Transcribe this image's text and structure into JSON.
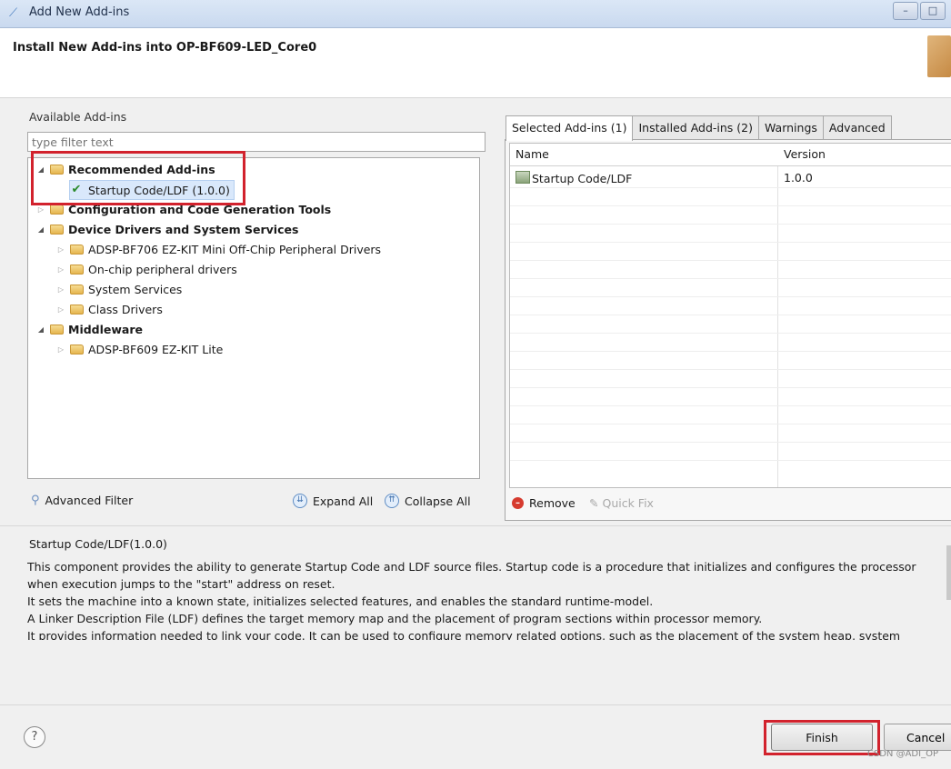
{
  "window": {
    "title": "Add New Add-ins"
  },
  "header": {
    "title": "Install New Add-ins into OP-BF609-LED_Core0"
  },
  "left": {
    "label": "Available Add-ins",
    "filter_placeholder": "type filter text",
    "tree": [
      {
        "text": "Recommended Add-ins"
      },
      {
        "text": "Startup Code/LDF (1.0.0)"
      },
      {
        "text": "Configuration and Code Generation Tools"
      },
      {
        "text": "Device Drivers and System Services"
      },
      {
        "text": "ADSP-BF706 EZ-KIT Mini Off-Chip Peripheral Drivers"
      },
      {
        "text": "On-chip peripheral drivers"
      },
      {
        "text": "System Services"
      },
      {
        "text": "Class Drivers"
      },
      {
        "text": "Middleware"
      },
      {
        "text": "ADSP-BF609 EZ-KIT Lite"
      }
    ],
    "advanced_filter": "Advanced Filter",
    "expand_all": "Expand All",
    "collapse_all": "Collapse All"
  },
  "right": {
    "tabs": [
      "Selected Add-ins (1)",
      "Installed Add-ins (2)",
      "Warnings",
      "Advanced"
    ],
    "columns": [
      "Name",
      "Version"
    ],
    "rows": [
      {
        "name": "Startup Code/LDF",
        "version": "1.0.0"
      }
    ],
    "remove": "Remove",
    "quick_fix": "Quick Fix"
  },
  "description": {
    "title": "Startup Code/LDF(1.0.0)",
    "lines": [
      "This component provides the ability to generate Startup Code and LDF source files. Startup code is a procedure that initializes and configures the processor",
      "when execution jumps to the \"start\" address on reset.",
      "It sets the machine into a known state, initializes selected features, and enables the standard runtime-model.",
      "A Linker Description File (LDF) defines the target memory map and the placement of program sections within processor memory.",
      "It provides information needed to link your code. It can be used to configure memory related options, such as the placement of the system heap, system"
    ]
  },
  "footer": {
    "help": "?",
    "finish": "Finish",
    "cancel": "Cancel"
  },
  "watermark": "CSDN @ADI_OP",
  "colors": {
    "highlight_box": "#d2222d",
    "selection": "#d9e8fb"
  }
}
